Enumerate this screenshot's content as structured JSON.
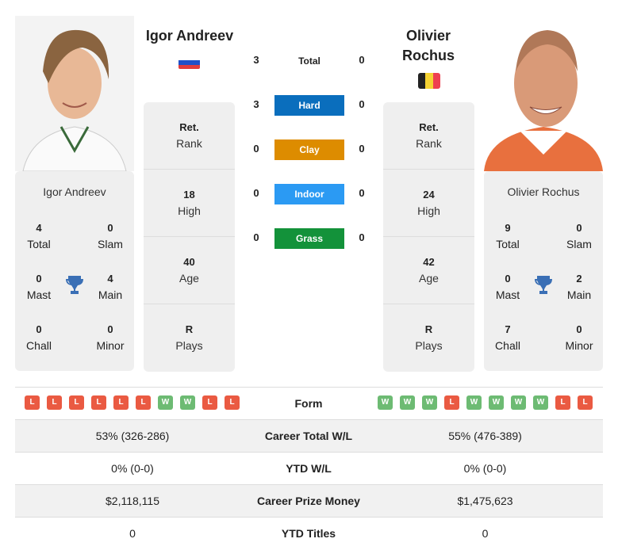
{
  "player1": {
    "name": "Igor Andreev",
    "card_name": "Igor Andreev",
    "flag": "russia-flag",
    "titles": {
      "total": {
        "value": "4",
        "label": "Total"
      },
      "slam": {
        "value": "0",
        "label": "Slam"
      },
      "mast": {
        "value": "0",
        "label": "Mast"
      },
      "main": {
        "value": "4",
        "label": "Main"
      },
      "chall": {
        "value": "0",
        "label": "Chall"
      },
      "minor": {
        "value": "0",
        "label": "Minor"
      }
    },
    "info": [
      {
        "value": "Ret.",
        "label": "Rank"
      },
      {
        "value": "18",
        "label": "High"
      },
      {
        "value": "40",
        "label": "Age"
      },
      {
        "value": "R",
        "label": "Plays"
      }
    ],
    "form": [
      "L",
      "L",
      "L",
      "L",
      "L",
      "L",
      "W",
      "W",
      "L",
      "L"
    ]
  },
  "player2": {
    "name_line1": "Olivier",
    "name_line2": "Rochus",
    "card_name": "Olivier Rochus",
    "flag": "belgium-flag",
    "titles": {
      "total": {
        "value": "9",
        "label": "Total"
      },
      "slam": {
        "value": "0",
        "label": "Slam"
      },
      "mast": {
        "value": "0",
        "label": "Mast"
      },
      "main": {
        "value": "2",
        "label": "Main"
      },
      "chall": {
        "value": "7",
        "label": "Chall"
      },
      "minor": {
        "value": "0",
        "label": "Minor"
      }
    },
    "info": [
      {
        "value": "Ret.",
        "label": "Rank"
      },
      {
        "value": "24",
        "label": "High"
      },
      {
        "value": "42",
        "label": "Age"
      },
      {
        "value": "R",
        "label": "Plays"
      }
    ],
    "form": [
      "W",
      "W",
      "W",
      "L",
      "W",
      "W",
      "W",
      "W",
      "L",
      "L"
    ]
  },
  "h2h": {
    "total": {
      "label": "Total",
      "p1": "3",
      "p2": "0"
    },
    "surfaces": [
      {
        "label": "Hard",
        "p1": "3",
        "p2": "0",
        "color": "#0a6ebd"
      },
      {
        "label": "Clay",
        "p1": "0",
        "p2": "0",
        "color": "#dd8c00"
      },
      {
        "label": "Indoor",
        "p1": "0",
        "p2": "0",
        "color": "#2b9af3"
      },
      {
        "label": "Grass",
        "p1": "0",
        "p2": "0",
        "color": "#13923a"
      }
    ]
  },
  "form_label": "Form",
  "comparison": [
    {
      "label": "Career Total W/L",
      "p1": "53% (326-286)",
      "p2": "55% (476-389)"
    },
    {
      "label": "YTD W/L",
      "p1": "0% (0-0)",
      "p2": "0% (0-0)"
    },
    {
      "label": "Career Prize Money",
      "p1": "$2,118,115",
      "p2": "$1,475,623"
    },
    {
      "label": "YTD Titles",
      "p1": "0",
      "p2": "0"
    }
  ],
  "colors": {
    "win": "#6dbb73",
    "loss": "#ea5a42",
    "trophy": "#3a6fb5"
  }
}
